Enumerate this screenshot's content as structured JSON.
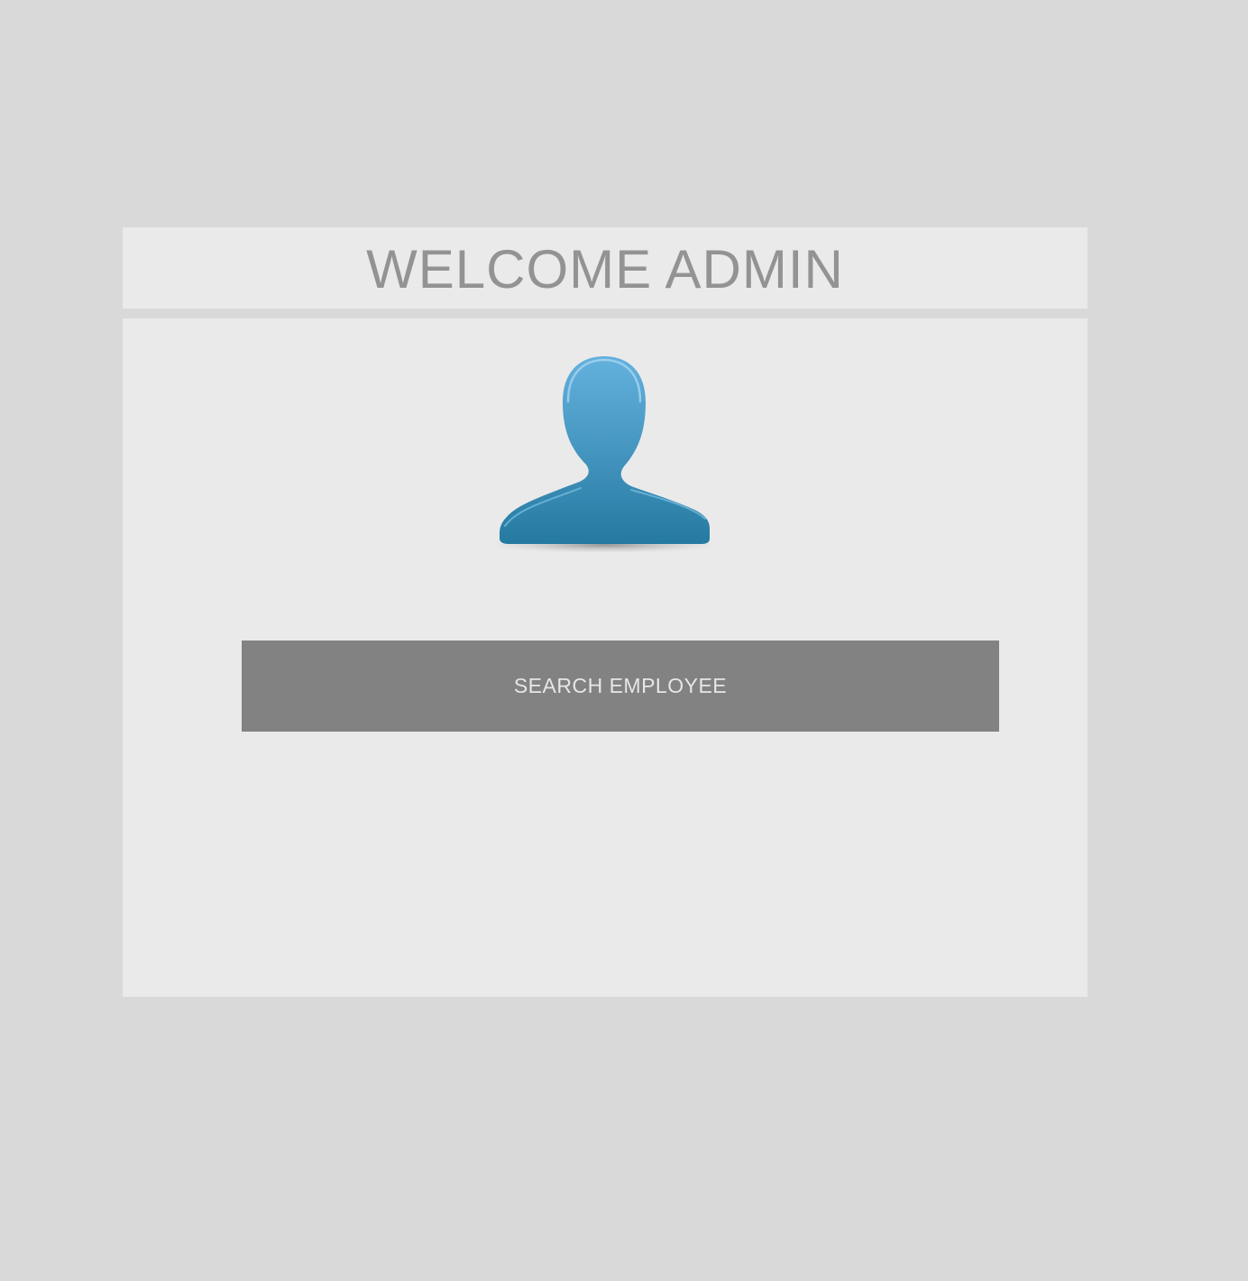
{
  "header": {
    "title": "WELCOME ADMIN"
  },
  "main": {
    "avatar_icon": "user-silhouette-icon",
    "search_button_label": "SEARCH EMPLOYEE"
  },
  "colors": {
    "background": "#d9d9d9",
    "panel": "#eaeaea",
    "title_text": "#939393",
    "button_bg": "#828282",
    "button_text": "#e6e6e6",
    "avatar_top": "#64b1de",
    "avatar_bottom": "#257aa1"
  }
}
